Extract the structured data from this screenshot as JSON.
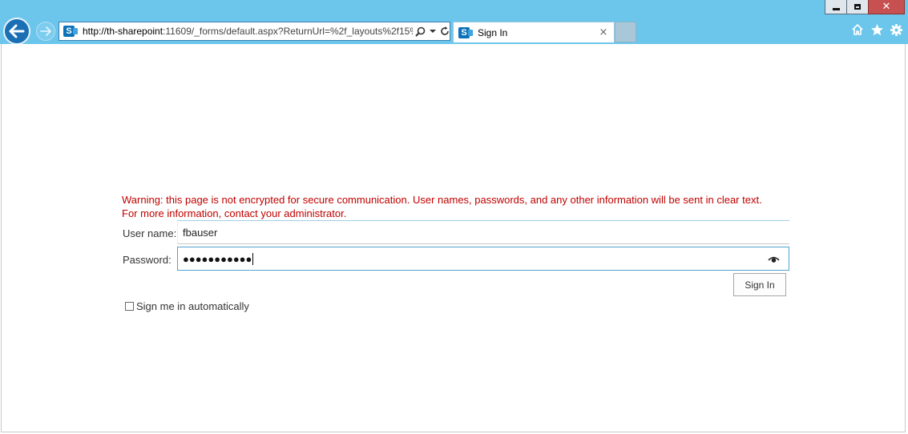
{
  "browser": {
    "url_host": "http://th-sharepoint",
    "url_rest": ":11609/_forms/default.aspx?ReturnUrl=%2f_layouts%2f15%",
    "tab_title": "Sign In",
    "tab_close": "×",
    "site_icon_letter": "S",
    "window_close": "✕"
  },
  "form": {
    "warning_line1": "Warning: this page is not encrypted for secure communication. User names, passwords, and any other information will be sent in clear text.",
    "warning_line2": "For more information, contact your administrator.",
    "username_label": "User name:",
    "username_value": "fbauser",
    "password_label": "Password:",
    "password_masked": "●●●●●●●●●●●",
    "signin_label": "Sign In",
    "remember_label": "Sign me in automatically",
    "remember_checked": false
  },
  "colors": {
    "chrome": "#6cc6ec",
    "warning": "#c00000",
    "accent": "#1a6fb5"
  },
  "icons": [
    "back-arrow-icon",
    "forward-arrow-icon",
    "search-icon",
    "dropdown-icon",
    "refresh-icon",
    "home-icon",
    "star-icon",
    "gear-icon",
    "eye-icon"
  ]
}
